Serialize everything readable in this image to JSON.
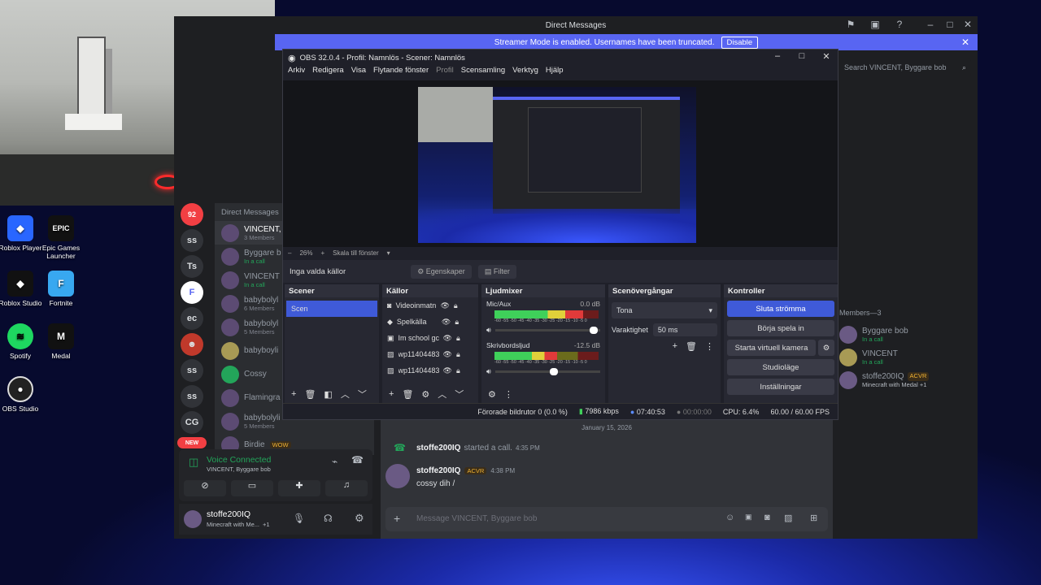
{
  "desktop": {
    "icons": [
      {
        "label": "Roblox Player",
        "icon": "roblox-icon"
      },
      {
        "label": "Epic Games Launcher",
        "icon": "epic-games-icon"
      },
      {
        "label": "Roblox Studio",
        "icon": "roblox-studio-icon"
      },
      {
        "label": "Fortnite",
        "icon": "fortnite-icon"
      },
      {
        "label": "Spotify",
        "icon": "spotify-icon"
      },
      {
        "label": "Medal",
        "icon": "medal-icon"
      },
      {
        "label": "OBS Studio",
        "icon": "obs-icon"
      }
    ]
  },
  "discord": {
    "title": "Direct Messages",
    "streamer_banner": "Streamer Mode is enabled. Usernames have been truncated.",
    "disable_label": "Disable",
    "dm_header": "Direct Messages",
    "servers": [
      "ss",
      "Ts",
      "ec",
      "ss",
      "ss",
      "CG"
    ],
    "new_badge": "NEW",
    "dms": [
      {
        "name": "VINCENT,",
        "sub": "3 Members"
      },
      {
        "name": "Byggare b",
        "sub": "In a call"
      },
      {
        "name": "VINCENT",
        "sub": "In a call"
      },
      {
        "name": "babybolyl",
        "sub": "6 Members"
      },
      {
        "name": "babybolyl",
        "sub": "5 Members"
      },
      {
        "name": "babyboyli",
        "sub": ""
      },
      {
        "name": "Cossy",
        "sub": ""
      },
      {
        "name": "Flamingra",
        "sub": ""
      },
      {
        "name": "babybolyli",
        "sub": "5 Members"
      },
      {
        "name": "Birdie",
        "sub": "WOW"
      }
    ],
    "voice": {
      "status": "Voice Connected",
      "channel": "VINCENT, Byggare bob"
    },
    "user": {
      "name": "stoffe200IQ",
      "activity": "Minecraft with Me...",
      "extra": "+1"
    },
    "search_placeholder": "Search VINCENT, Byggare bob",
    "date_divider": "January 15, 2026",
    "messages": [
      {
        "author": "stoffe200IQ",
        "text": "started a call.",
        "time": "4:35 PM"
      },
      {
        "author": "stoffe200IQ",
        "badge": "ACVR",
        "time": "4:38 PM",
        "text": "cossy dih /"
      }
    ],
    "message_placeholder": "Message VINCENT, Byggare bob",
    "members_header": "Members—3",
    "members": [
      {
        "name": "Byggare bob",
        "status": "In a call"
      },
      {
        "name": "VINCENT",
        "status": "In a call"
      },
      {
        "name": "stoffe200IQ",
        "badge": "ACVR",
        "status": "Minecraft with Medal +1"
      }
    ]
  },
  "obs": {
    "title": "OBS 32.0.4 - Profil: Namnlös - Scener: Namnlös",
    "menu": [
      "Arkiv",
      "Redigera",
      "Visa",
      "Flytande fönster",
      "Profil",
      "Scensamling",
      "Verktyg",
      "Hjälp"
    ],
    "zoom": "26%",
    "scale_mode": "Skala till fönster",
    "no_source": "Inga valda källor",
    "properties": "Egenskaper",
    "filter": "Filter",
    "docks": {
      "scenes": "Scener",
      "sources": "Källor",
      "mixer": "Ljudmixer",
      "transitions": "Scenövergångar",
      "controls": "Kontroller"
    },
    "scenes": [
      "Scen"
    ],
    "sources": [
      "Videoinmatn",
      "Spelkälla",
      "Im school gc",
      "wp11404483",
      "wp11404483"
    ],
    "mixer": [
      {
        "name": "Mic/Aux",
        "db": "0.0 dB",
        "level": 0.85,
        "vol": 0.98
      },
      {
        "name": "Skrivbordsljud",
        "db": "-12.5 dB",
        "level": 0.6,
        "vol": 0.6
      }
    ],
    "meter_ticks": "-60 -55 -50 -45 -40 -35 -30 -25 -20 -15 -10 -5 0",
    "transition": "Tona",
    "duration_label": "Varaktighet",
    "duration": "50 ms",
    "controls": [
      "Sluta strömma",
      "Börja spela in",
      "Starta virtuell kamera",
      "Studioläge",
      "Inställningar"
    ],
    "status": {
      "dropped": "Förorade bildrutor 0 (0.0 %)",
      "kbps": "7986 kbps",
      "stream_time": "07:40:53",
      "rec_time": "00:00:00",
      "cpu": "CPU: 6.4%",
      "fps": "60.00 / 60.00 FPS"
    }
  }
}
